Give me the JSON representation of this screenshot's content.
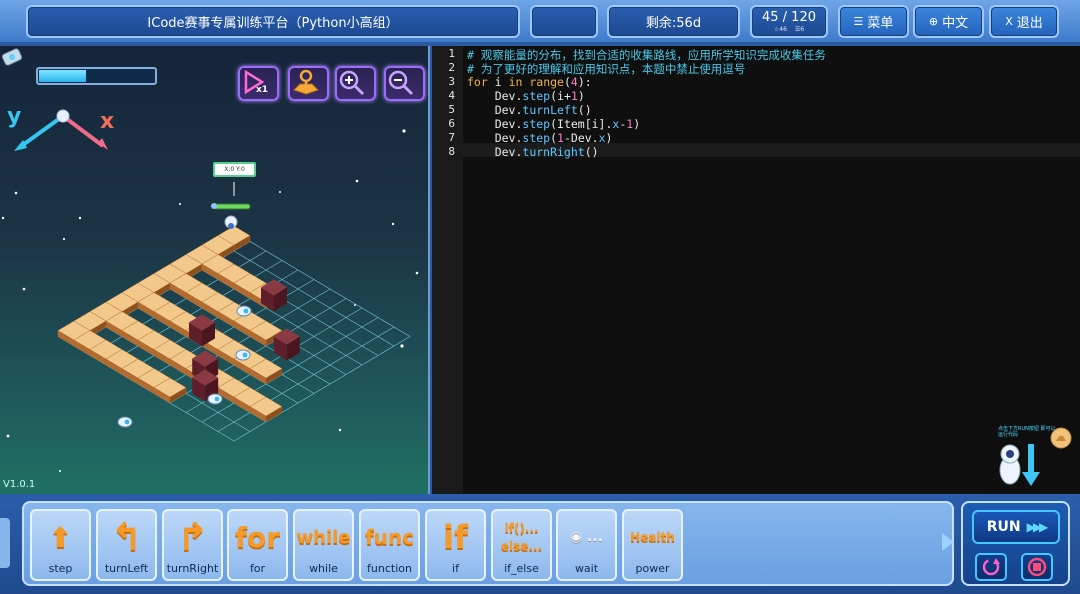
{
  "header": {
    "title": "ICode赛事专属训练平台（Python小高组）",
    "time_left": "剩余:56d",
    "score": "45 / 120",
    "score_sub_a": "46",
    "score_sub_b": "6",
    "menu_label": "菜单",
    "lang_label": "中文",
    "exit_label": "退出"
  },
  "game": {
    "version": "V1.0.1",
    "energy_percent": 40,
    "axis_y": "y",
    "axis_x": "x",
    "coord_tag": "X:0 Y:0",
    "buttons": [
      "speed-x1",
      "map",
      "zoom-in",
      "zoom-out"
    ]
  },
  "editor": {
    "line_numbers": [
      "1",
      "2",
      "3",
      "4",
      "5",
      "6",
      "7",
      "8"
    ],
    "lines": [
      "# 观察能量的分布，找到合适的收集路线，应用所学知识完成收集任务",
      "# 为了更好的理解和应用知识点，本题中禁止使用逗号",
      "for i in range(4):",
      "    Dev.step(i+1)",
      "    Dev.turnLeft()",
      "    Dev.step(Item[i].x-1)",
      "    Dev.step(1-Dev.x)",
      "    Dev.turnRight()"
    ],
    "helper_text": "点击下方RUN按钮 即可以运行代码"
  },
  "toolbar": {
    "blocks": [
      {
        "label": "step",
        "glyph": "step"
      },
      {
        "label": "turnLeft",
        "glyph": "turnLeft"
      },
      {
        "label": "turnRight",
        "glyph": "turnRight"
      },
      {
        "label": "for",
        "glyph": "for"
      },
      {
        "label": "while",
        "glyph": "while"
      },
      {
        "label": "function",
        "glyph": "func"
      },
      {
        "label": "if",
        "glyph": "if"
      },
      {
        "label": "if_else",
        "glyph": "if()... else..."
      },
      {
        "label": "wait",
        "glyph": "wait"
      },
      {
        "label": "power",
        "glyph": "Health"
      }
    ],
    "run_label": "RUN"
  }
}
